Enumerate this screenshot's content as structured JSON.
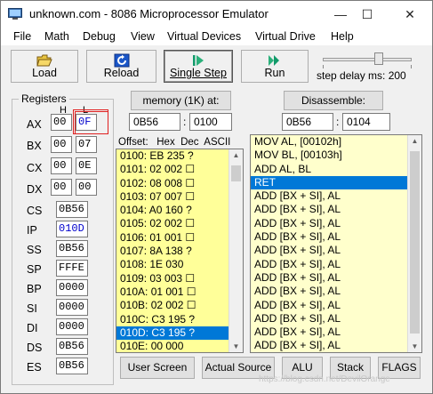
{
  "window": {
    "title": "unknown.com - 8086 Microprocessor Emulator",
    "minimize_glyph": "—",
    "maximize_glyph": "☐",
    "close_glyph": "✕"
  },
  "menu": [
    "File",
    "Math",
    "Debug",
    "View",
    "Virtual Devices",
    "Virtual Drive",
    "Help"
  ],
  "toolbar": {
    "load": "Load",
    "reload": "Reload",
    "single_step": "Single Step",
    "run": "Run"
  },
  "step_delay": {
    "label": "step delay ms: 200",
    "value_ms": 200
  },
  "registers": {
    "title": "Registers",
    "h_label": "H",
    "l_label": "L",
    "general": [
      {
        "name": "AX",
        "h": "00",
        "l": "0F"
      },
      {
        "name": "BX",
        "h": "00",
        "l": "07"
      },
      {
        "name": "CX",
        "h": "00",
        "l": "0E"
      },
      {
        "name": "DX",
        "h": "00",
        "l": "00"
      }
    ],
    "other": [
      {
        "name": "CS",
        "value": "0B56"
      },
      {
        "name": "IP",
        "value": "010D"
      },
      {
        "name": "SS",
        "value": "0B56"
      },
      {
        "name": "SP",
        "value": "FFFE"
      },
      {
        "name": "BP",
        "value": "0000"
      },
      {
        "name": "SI",
        "value": "0000"
      },
      {
        "name": "DI",
        "value": "0000"
      },
      {
        "name": "DS",
        "value": "0B56"
      },
      {
        "name": "ES",
        "value": "0B56"
      }
    ]
  },
  "memory": {
    "button": "memory (1K) at:",
    "segment": "0B56",
    "offset": "0100",
    "header": "Offset:   Hex  Dec  ASCII",
    "rows": [
      "0100: EB 235 ?",
      "0101: 02 002 ☐",
      "0102: 08 008 ☐",
      "0103: 07 007 ☐",
      "0104: A0 160 ?",
      "0105: 02 002 ☐",
      "0106: 01 001 ☐",
      "0107: 8A 138 ?",
      "0108: 1E 030",
      "0109: 03 003 ☐",
      "010A: 01 001 ☐",
      "010B: 02 002 ☐",
      "010C: C3 195 ?",
      "010D: C3 195 ?",
      "010E: 00 000"
    ],
    "selected_index": 13
  },
  "disassemble": {
    "button": "Disassemble:",
    "segment": "0B56",
    "offset": "0104",
    "rows": [
      "MOV AL, [00102h]",
      "MOV BL, [00103h]",
      "ADD AL, BL",
      "RET",
      "ADD [BX + SI], AL",
      "ADD [BX + SI], AL",
      "ADD [BX + SI], AL",
      "ADD [BX + SI], AL",
      "ADD [BX + SI], AL",
      "ADD [BX + SI], AL",
      "ADD [BX + SI], AL",
      "ADD [BX + SI], AL",
      "ADD [BX + SI], AL",
      "ADD [BX + SI], AL",
      "ADD [BX + SI], AL",
      "ADD [BX + SI], AL"
    ],
    "selected_index": 3
  },
  "bottom_buttons": {
    "user_screen": "User Screen",
    "actual_source": "Actual Source",
    "alu": "ALU",
    "stack": "Stack",
    "flags": "FLAGS"
  },
  "watermark": "https://blog.csdn.net/DevilOrange",
  "colors": {
    "selection": "#0078d7",
    "memory_bg": "#ffff99",
    "disasm_bg": "#ffffcc",
    "annotation": "#e02020",
    "register_highlight": "#0000cc"
  }
}
